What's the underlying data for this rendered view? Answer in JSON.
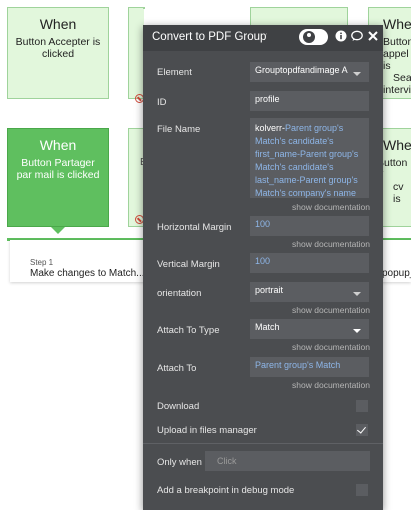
{
  "cards": {
    "top1": {
      "title": "When",
      "desc": "Button Accepter is clicked"
    },
    "top2_partial": "When",
    "top3_partial": "When",
    "top4": {
      "title": "When",
      "desc_lines": [
        "Button",
        "appel is",
        "Sea",
        "intervie"
      ]
    },
    "bottom1": {
      "title": "When",
      "desc": "Button Partager par mail is clicked"
    },
    "bottom2_partial": "E",
    "bottom4": {
      "title": "When",
      "desc_lines": [
        "Button T",
        "cv is"
      ]
    }
  },
  "steps": {
    "step_label": "Step 1",
    "step_desc": "Make changes to Match...",
    "right_step": "popup_s"
  },
  "panel": {
    "title": "Convert to PDF Groupto|",
    "fields": {
      "element": {
        "label": "Element",
        "value": "Groupt​opdfandimage A"
      },
      "id": {
        "label": "ID",
        "value": "profile"
      },
      "file_name": {
        "label": "File Name",
        "lines": [
          {
            "parts": [
              {
                "t": "kolverr-",
                "c": "w"
              },
              {
                "t": "Parent group's",
                "c": "b"
              }
            ]
          },
          {
            "parts": [
              {
                "t": "Match's candidate's",
                "c": "b"
              }
            ]
          },
          {
            "parts": [
              {
                "t": "first_name-",
                "c": "b"
              },
              {
                "t": "Parent group's",
                "c": "b"
              }
            ]
          },
          {
            "parts": [
              {
                "t": "Match's candidate's",
                "c": "b"
              }
            ]
          },
          {
            "parts": [
              {
                "t": "last_name-",
                "c": "b"
              },
              {
                "t": "Parent group's",
                "c": "b"
              }
            ]
          },
          {
            "parts": [
              {
                "t": "Match's company's name",
                "c": "b"
              }
            ]
          }
        ]
      },
      "horizontal_margin": {
        "label": "Horizontal Margin",
        "value": "100"
      },
      "vertical_margin": {
        "label": "Vertical Margin",
        "value": "100"
      },
      "orientation": {
        "label": "orientation",
        "value": "portrait"
      },
      "attach_to_type": {
        "label": "Attach To Type",
        "value": "Match"
      },
      "attach_to": {
        "label": "Attach To",
        "value": "Parent group's Match"
      },
      "download": {
        "label": "Download",
        "checked": false
      },
      "upload": {
        "label": "Upload in files manager",
        "checked": true
      },
      "only_when": {
        "label": "Only when",
        "placeholder": "Click"
      },
      "breakpoint": {
        "label": "Add a breakpoint in debug mode"
      }
    },
    "show_documentation": "show documentation"
  },
  "colors": {
    "panel": "#4b4d50",
    "field": "#5b5d61",
    "dynamic_text": "#8eb6e8",
    "card_green": "#e2f7dc",
    "card_dark": "#5fbf5f"
  },
  "icons": [
    "info-icon",
    "comment-icon",
    "close-icon",
    "no-entry-icon",
    "dropdown-arrow-icon",
    "checkbox-icon"
  ]
}
